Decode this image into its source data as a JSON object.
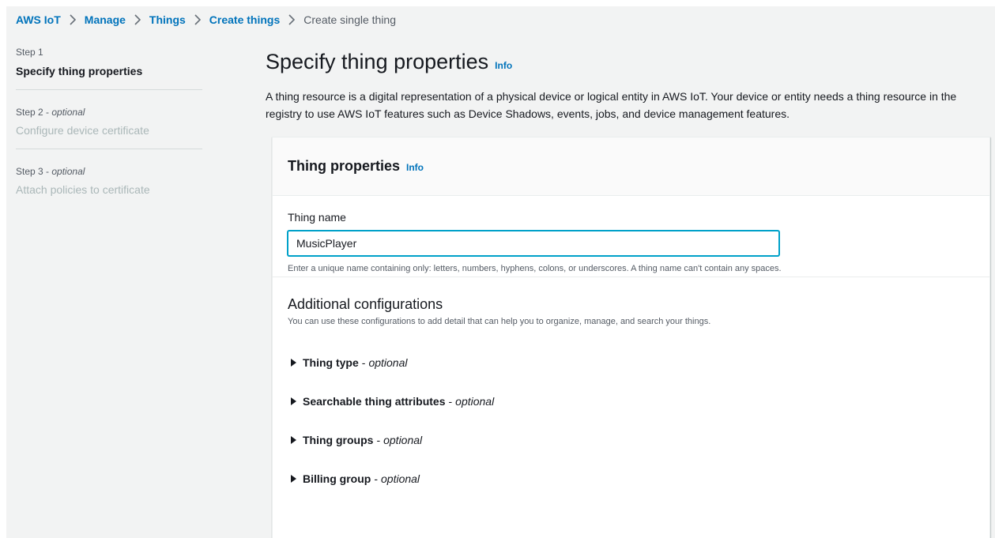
{
  "breadcrumb": {
    "items": [
      "AWS IoT",
      "Manage",
      "Things",
      "Create things"
    ],
    "current": "Create single thing"
  },
  "steps": [
    {
      "num": "Step 1",
      "title": "Specify thing properties"
    },
    {
      "num": "Step 2",
      "optional": "optional",
      "title": "Configure device certificate"
    },
    {
      "num": "Step 3",
      "optional": "optional",
      "title": "Attach policies to certificate"
    }
  ],
  "page": {
    "title": "Specify thing properties",
    "info": "Info",
    "description": "A thing resource is a digital representation of a physical device or logical entity in AWS IoT. Your device or entity needs a thing resource in the registry to use AWS IoT features such as Device Shadows, events, jobs, and device management features."
  },
  "panel": {
    "title": "Thing properties",
    "info": "Info",
    "thing_name": {
      "label": "Thing name",
      "value": "MusicPlayer",
      "help": "Enter a unique name containing only: letters, numbers, hyphens, colons, or underscores. A thing name can't contain any spaces."
    },
    "additional": {
      "title": "Additional configurations",
      "description": "You can use these configurations to add detail that can help you to organize, manage, and search your things.",
      "expanders": [
        {
          "title": "Thing type",
          "optional": "optional"
        },
        {
          "title": "Searchable thing attributes",
          "optional": "optional"
        },
        {
          "title": "Thing groups",
          "optional": "optional"
        },
        {
          "title": "Billing group",
          "optional": "optional"
        }
      ]
    }
  },
  "colors": {
    "link": "#0073bb",
    "focus": "#00a1c9",
    "disabled": "#aab7b8",
    "background": "#f2f3f3"
  }
}
